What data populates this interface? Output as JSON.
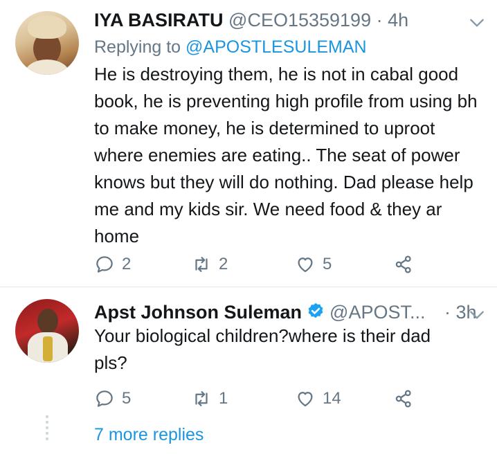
{
  "tweets": [
    {
      "author_name": "IYA BASIRATU",
      "handle": "@CEO15359199",
      "separator": "·",
      "time": "4h",
      "replying_prefix": "Replying to",
      "replying_to": "@APOSTLESULEMAN",
      "text": "He is destroying them, he is not in cabal good book, he is preventing high profile from using bh to make money, he is determined to uproot where enemies are eating.. The seat of power knows but they will do nothing. Dad please help me and my kids sir. We need food & they ar home",
      "replies": "2",
      "retweets": "2",
      "likes": "5",
      "verified": false
    },
    {
      "author_name": "Apst Johnson Suleman",
      "handle": "@APOST...",
      "separator": "·",
      "time": "3h",
      "text": "Your biological children?where is their dad pls?",
      "replies": "5",
      "retweets": "1",
      "likes": "14",
      "verified": true
    }
  ],
  "more_replies": "7 more replies",
  "colors": {
    "accent": "#1b95e0",
    "muted": "#657786",
    "text": "#14171a",
    "border": "#e1e8ed"
  },
  "icons": [
    "reply-icon",
    "retweet-icon",
    "like-icon",
    "share-icon",
    "chevron-down-icon",
    "verified-badge-icon"
  ]
}
